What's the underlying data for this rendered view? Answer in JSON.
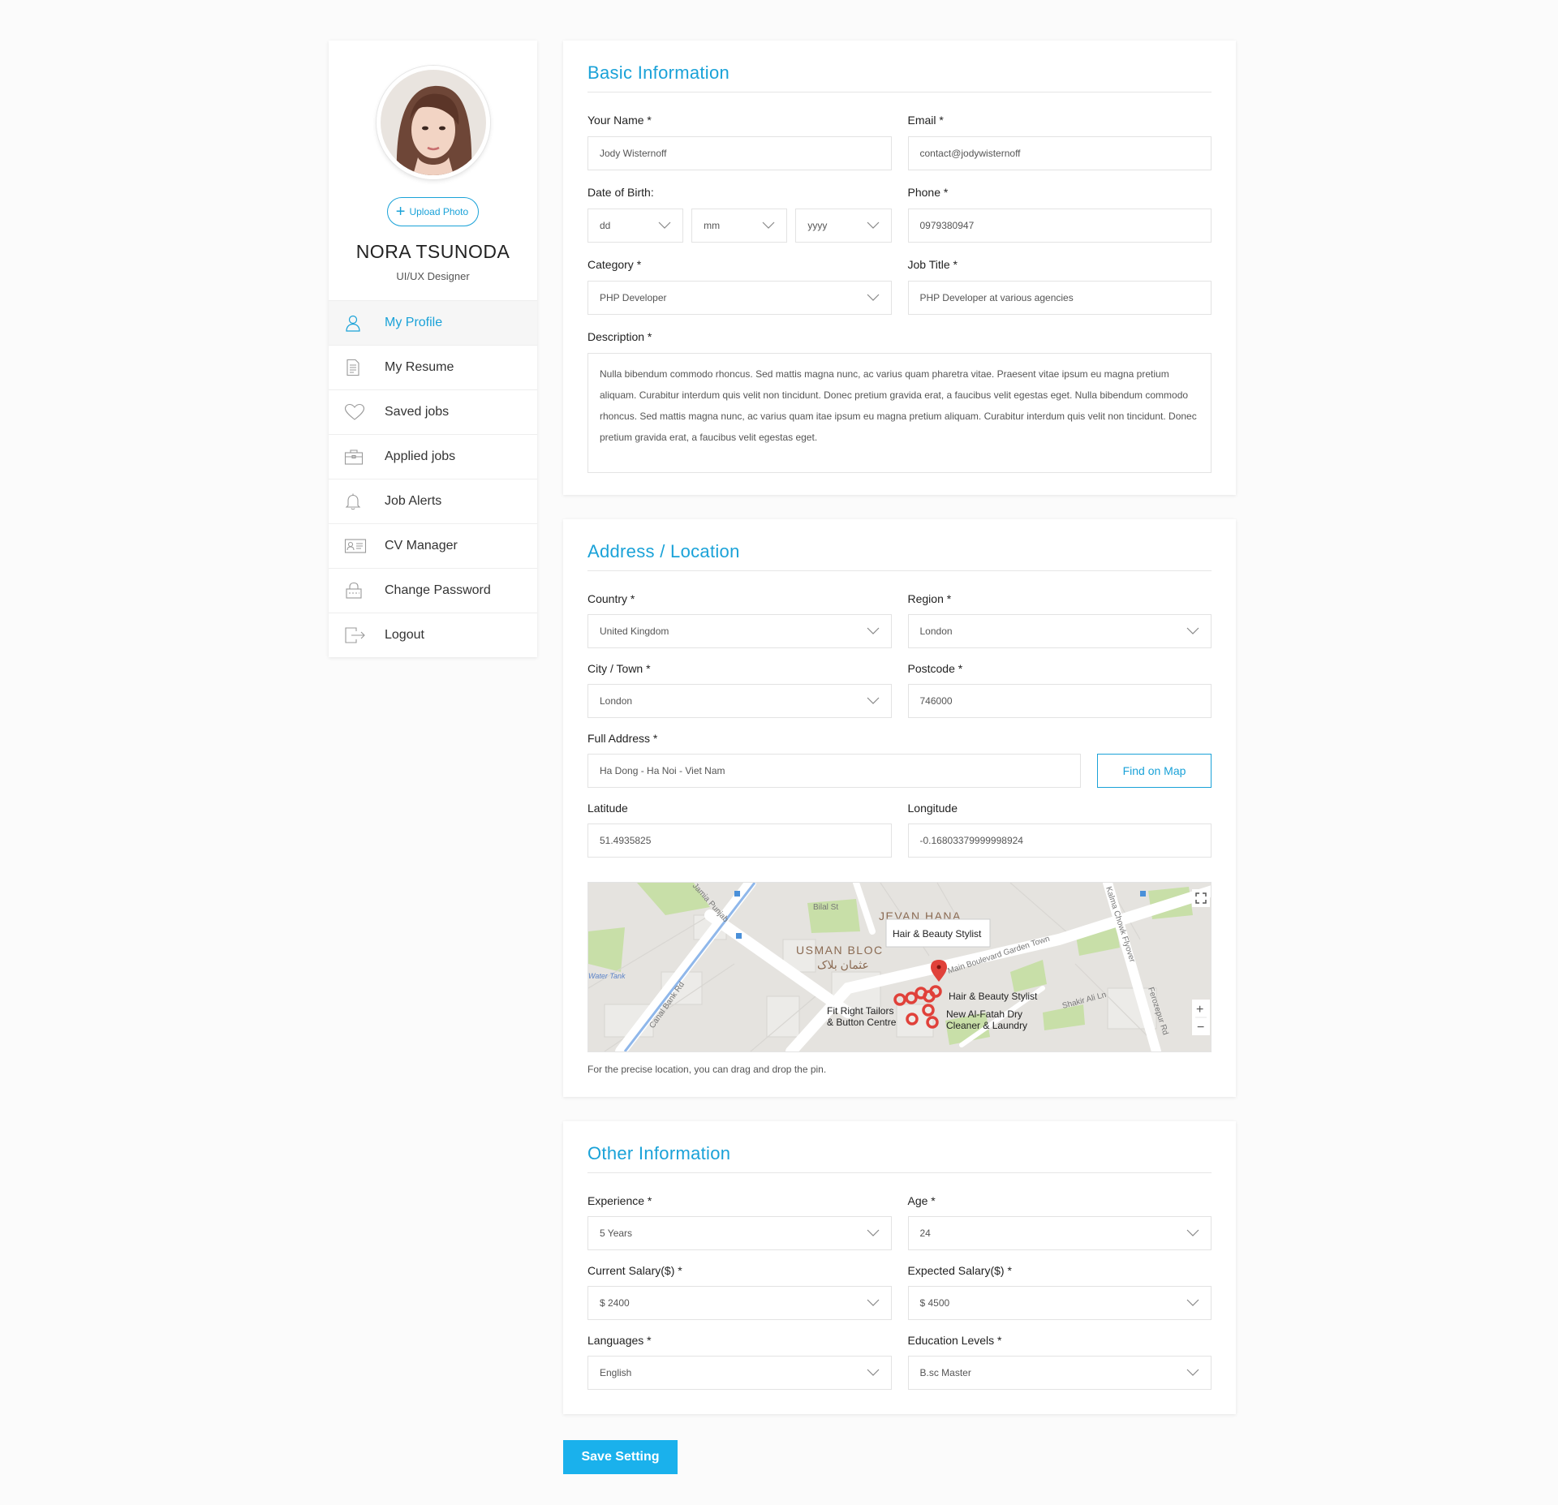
{
  "profile": {
    "upload_label": "Upload Photo",
    "name": "NORA TSUNODA",
    "role": "UI/UX Designer"
  },
  "menu": [
    {
      "label": "My Profile",
      "icon": "user-icon",
      "active": true
    },
    {
      "label": "My Resume",
      "icon": "document-icon"
    },
    {
      "label": "Saved jobs",
      "icon": "heart-icon"
    },
    {
      "label": "Applied jobs",
      "icon": "briefcase-icon"
    },
    {
      "label": "Job Alerts",
      "icon": "bell-icon"
    },
    {
      "label": "CV Manager",
      "icon": "id-card-icon"
    },
    {
      "label": "Change Password",
      "icon": "lock-icon"
    },
    {
      "label": "Logout",
      "icon": "logout-icon"
    }
  ],
  "basic": {
    "title": "Basic Information",
    "name_label": "Your Name *",
    "name_value": "Jody Wisternoff",
    "email_label": "Email *",
    "email_value": "contact@jodywisternoff",
    "dob_label": "Date of Birth:",
    "dob_dd": "dd",
    "dob_mm": "mm",
    "dob_yyyy": "yyyy",
    "phone_label": "Phone *",
    "phone_value": "0979380947",
    "category_label": "Category *",
    "category_value": "PHP Developer",
    "job_title_label": "Job Title *",
    "job_title_value": "PHP Developer at various agencies",
    "description_label": "Description *",
    "description_value": "Nulla bibendum commodo rhoncus. Sed mattis magna nunc, ac varius quam pharetra vitae. Praesent vitae ipsum eu magna pretium aliquam. Curabitur interdum quis velit non tincidunt. Donec pretium gravida erat, a faucibus velit egestas eget. Nulla bibendum commodo rhoncus. Sed mattis magna nunc, ac varius quam itae ipsum eu magna pretium aliquam. Curabitur interdum quis velit non tincidunt. Donec pretium gravida erat, a faucibus velit egestas eget."
  },
  "address": {
    "title": "Address / Location",
    "country_label": "Country *",
    "country_value": "United Kingdom",
    "region_label": "Region *",
    "region_value": "London",
    "city_label": "City / Town *",
    "city_value": "London",
    "postcode_label": "Postcode *",
    "postcode_value": "746000",
    "full_address_label": "Full Address *",
    "full_address_value": "Ha Dong - Ha Noi - Viet Nam",
    "find_button": "Find on Map",
    "latitude_label": "Latitude",
    "latitude_value": "51.4935825",
    "longitude_label": "Longitude",
    "longitude_value": "-0.16803379999998924",
    "map": {
      "tooltip": "Hair & Beauty Stylist",
      "area_1": "JEVAN HANA",
      "area_2": "USMAN BLOC",
      "area_2_urdu": "عثمان بلاک",
      "road_1": "Main Boulevard Garden Town",
      "road_2": "Canal Bank Rd",
      "road_3": "Jamia Punjab",
      "road_4": "Kalma Chowk Flyover",
      "road_5": "Ferozepur Rd",
      "road_6": "Shakir Ali Ln",
      "road_7": "Bilal St",
      "water": "Water Tank",
      "poi_1": "Hair & Beauty Stylist",
      "poi_2a": "Fit Right Tailors",
      "poi_2b": "& Button Centre",
      "poi_3a": "New Al-Fatah Dry",
      "poi_3b": "Cleaner & Laundry",
      "zoom_in": "+",
      "zoom_out": "−"
    },
    "map_note": "For the precise location, you can drag and drop the pin."
  },
  "other": {
    "title": "Other Information",
    "experience_label": "Experience *",
    "experience_value": "5 Years",
    "age_label": "Age *",
    "age_value": "24",
    "current_salary_label": "Current Salary($) *",
    "current_salary_value": "$ 2400",
    "expected_salary_label": "Expected Salary($) *",
    "expected_salary_value": "$ 4500",
    "languages_label": "Languages *",
    "languages_value": "English",
    "education_label": "Education Levels *",
    "education_value": "B.sc Master"
  },
  "save_button": "Save Setting",
  "colors": {
    "accent": "#1aa2d8",
    "save_bg": "#1ab1ec",
    "map_pin": "#e0413a"
  }
}
